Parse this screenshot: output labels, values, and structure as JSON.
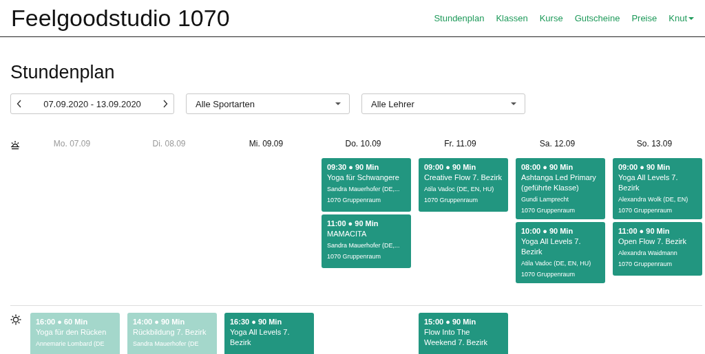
{
  "header": {
    "brand": "Feelgoodstudio 1070",
    "nav": [
      {
        "label": "Stundenplan",
        "dropdown": false
      },
      {
        "label": "Klassen",
        "dropdown": false
      },
      {
        "label": "Kurse",
        "dropdown": false
      },
      {
        "label": "Gutscheine",
        "dropdown": false
      },
      {
        "label": "Preise",
        "dropdown": false
      },
      {
        "label": "Knut",
        "dropdown": true
      }
    ]
  },
  "page_title": "Stundenplan",
  "filters": {
    "date_range": "07.09.2020 - 13.09.2020",
    "sport": "Alle Sportarten",
    "teacher": "Alle Lehrer"
  },
  "days": [
    {
      "label": "Mo. 07.09",
      "past": true,
      "afternoon": [
        {
          "time": "16:00 ● 60 Min",
          "title": "Yoga für den Rücken",
          "teacher": "Annemarie Lombard (DE"
        }
      ]
    },
    {
      "label": "Di. 08.09",
      "past": true,
      "afternoon": [
        {
          "time": "14:00 ● 90 Min",
          "title": "Rückbildung 7. Bezirk",
          "teacher": "Sandra Mauerhofer (DE"
        }
      ]
    },
    {
      "label": "Mi. 09.09",
      "past": false,
      "afternoon": [
        {
          "time": "16:30 ● 90 Min",
          "title": "Yoga All Levels 7. Bezirk"
        }
      ]
    },
    {
      "label": "Do. 10.09",
      "past": false,
      "morning": [
        {
          "time": "09:30 ● 90 Min",
          "title": "Yoga für Schwangere",
          "teacher": "Sandra Mauerhofer (DE,...",
          "room": "1070 Gruppenraum"
        },
        {
          "time": "11:00 ● 90 Min",
          "title": "MAMACITA",
          "teacher": "Sandra Mauerhofer (DE,...",
          "room": "1070 Gruppenraum"
        }
      ]
    },
    {
      "label": "Fr. 11.09",
      "past": false,
      "morning": [
        {
          "time": "09:00 ● 90 Min",
          "title": "Creative Flow 7. Bezirk",
          "teacher": "Atila Vadoc (DE, EN, HU)",
          "room": "1070 Gruppenraum"
        }
      ],
      "afternoon": [
        {
          "time": "15:00 ● 90 Min",
          "title": "Flow Into The Weekend 7. Bezirk"
        }
      ]
    },
    {
      "label": "Sa. 12.09",
      "past": false,
      "morning": [
        {
          "time": "08:00 ● 90 Min",
          "title": "Ashtanga Led Primary (geführte Klasse)",
          "teacher": "Gundi Lamprecht",
          "room": "1070 Gruppenraum"
        },
        {
          "time": "10:00 ● 90 Min",
          "title": "Yoga All Levels 7. Bezirk",
          "teacher": "Atila Vadoc (DE, EN, HU)",
          "room": "1070 Gruppenraum"
        }
      ]
    },
    {
      "label": "So. 13.09",
      "past": false,
      "morning": [
        {
          "time": "09:00 ● 90 Min",
          "title": "Yoga All Levels 7. Bezirk",
          "teacher": "Alexandra Wolk (DE, EN)",
          "room": "1070 Gruppenraum"
        },
        {
          "time": "11:00 ● 90 Min",
          "title": "Open Flow 7. Bezirk",
          "teacher": "Alexandra Waidmann",
          "room": "1070 Gruppenraum"
        }
      ]
    }
  ]
}
